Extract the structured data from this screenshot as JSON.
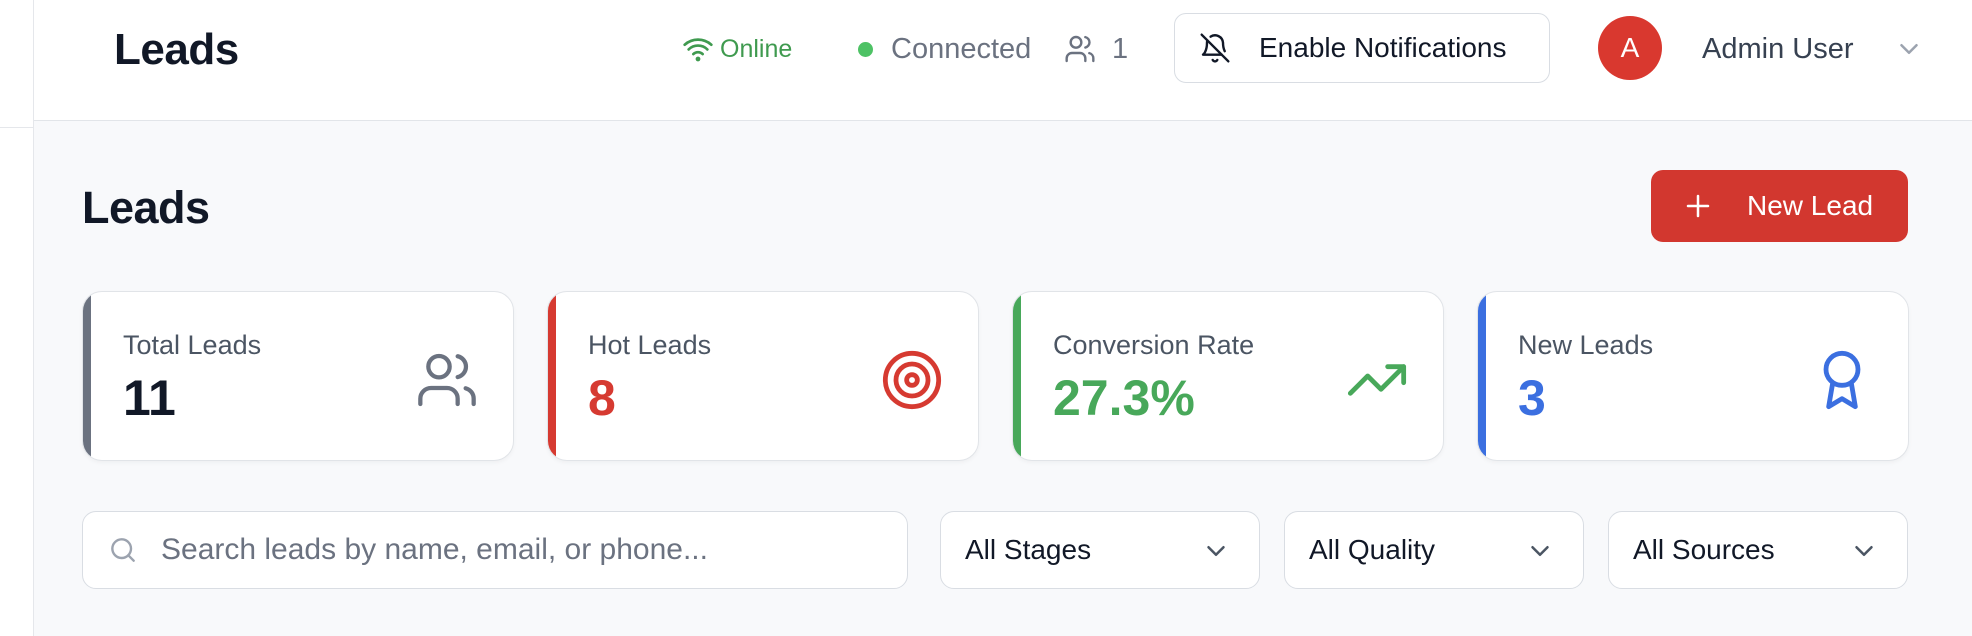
{
  "header": {
    "title": "Leads",
    "online_label": "Online",
    "connected_label": "Connected",
    "users_online_count": "1",
    "notifications_label": "Enable Notifications",
    "avatar_initial": "A",
    "user_name": "Admin User"
  },
  "page": {
    "title": "Leads",
    "new_lead_label": "New Lead"
  },
  "stats": [
    {
      "label": "Total Leads",
      "value": "11",
      "color": "#6b7280",
      "icon": "users-icon"
    },
    {
      "label": "Hot Leads",
      "value": "8",
      "color": "#d63a31",
      "icon": "target-icon"
    },
    {
      "label": "Conversion Rate",
      "value": "27.3%",
      "color": "#48a85a",
      "icon": "trending-up-icon"
    },
    {
      "label": "New Leads",
      "value": "3",
      "color": "#3b6fe0",
      "icon": "award-icon"
    }
  ],
  "filters": {
    "search_placeholder": "Search leads by name, email, or phone...",
    "stage": "All Stages",
    "quality": "All Quality",
    "source": "All Sources"
  },
  "colors": {
    "primary": "#d2372f",
    "online": "#3f9a4f",
    "connected_dot": "#4ec265",
    "neutral_accent": "#6b7280",
    "hot": "#d63a31",
    "conversion": "#48a85a",
    "new": "#3b6fe0"
  }
}
